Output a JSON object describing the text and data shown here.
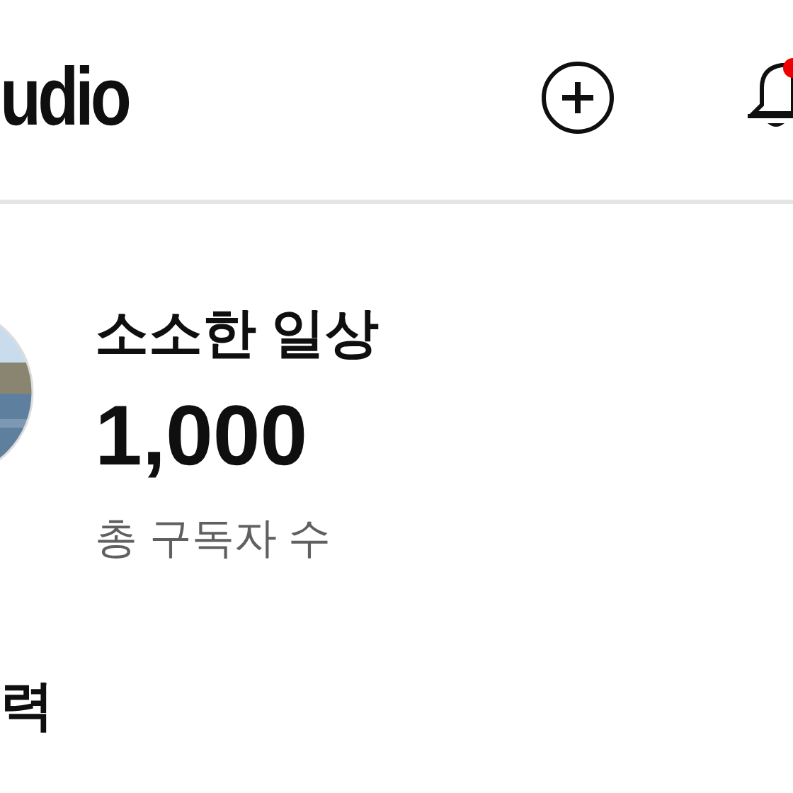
{
  "header": {
    "logo": "udio",
    "notification_dot": true
  },
  "channel": {
    "name": "소소한 일상",
    "subscribers": "1,000",
    "subscribers_label": "총 구독자 수"
  },
  "section": {
    "title": "력"
  }
}
